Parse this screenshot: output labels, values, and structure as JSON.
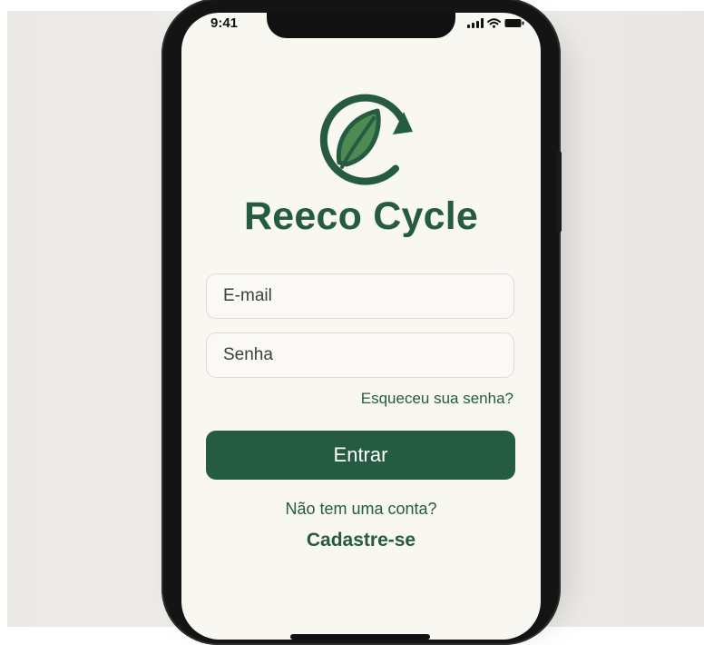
{
  "status_bar": {
    "time": "9:41"
  },
  "brand": {
    "app_name": "Reeco Cycle",
    "logo_icon": "recycle-leaf-icon",
    "primary_color": "#245b41"
  },
  "login_form": {
    "email_placeholder": "E-mail",
    "email_value": "",
    "password_placeholder": "Senha",
    "password_value": "",
    "forgot_password_label": "Esqueceu sua senha?",
    "submit_label": "Entrar"
  },
  "signup": {
    "prompt": "Não tem uma conta?",
    "link_label": "Cadastre-se"
  }
}
